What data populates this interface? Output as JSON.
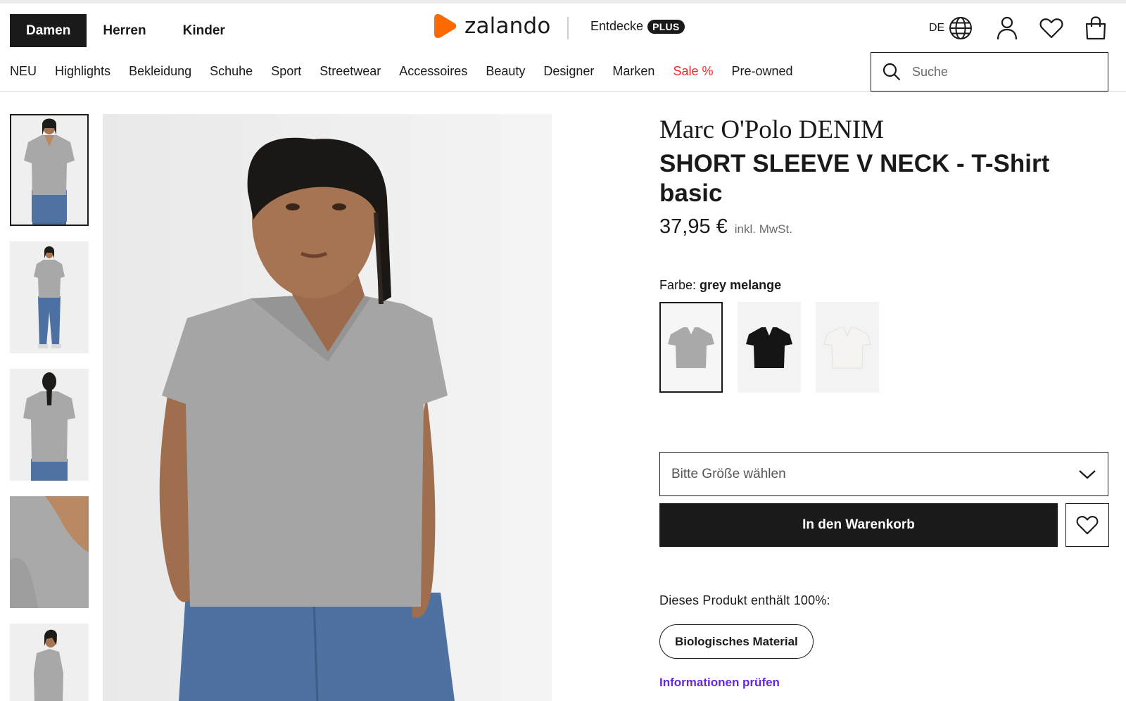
{
  "header": {
    "gender_tabs": [
      {
        "label": "Damen",
        "active": true
      },
      {
        "label": "Herren",
        "active": false
      },
      {
        "label": "Kinder",
        "active": false
      }
    ],
    "logo_text": "zalando",
    "logo_color": "#ff6900",
    "entdecke_label": "Entdecke",
    "plus_label": "PLUS",
    "language": "DE",
    "icons": [
      "globe-icon",
      "user-icon",
      "heart-icon",
      "bag-icon"
    ]
  },
  "nav": {
    "categories": [
      "NEU",
      "Highlights",
      "Bekleidung",
      "Schuhe",
      "Sport",
      "Streetwear",
      "Accessoires",
      "Beauty",
      "Designer",
      "Marken",
      "Sale %",
      "Pre-owned"
    ],
    "sale_color": "#ec2b2b",
    "search_placeholder": "Suche"
  },
  "product": {
    "brand": "Marc O'Polo DENIM",
    "name": "SHORT SLEEVE V NECK - T-Shirt basic",
    "price": "37,95 €",
    "vat_note": "inkl. MwSt.",
    "color_label": "Farbe:",
    "color_value": "grey melange",
    "swatches": [
      {
        "name": "grey melange",
        "color": "#a9a9a9",
        "selected": true
      },
      {
        "name": "black",
        "color": "#141414",
        "selected": false
      },
      {
        "name": "white",
        "color": "#f1f0ec",
        "selected": false
      }
    ],
    "size_placeholder": "Bitte Größe wählen",
    "add_to_cart": "In den Warenkorb",
    "material_text": "Dieses Produkt enthält 100%:",
    "material_badge": "Biologisches Material",
    "info_link": "Informationen prüfen",
    "info_link_color": "#6328e0"
  },
  "gallery": {
    "thumbnail_count": 5,
    "active_index": 0
  }
}
